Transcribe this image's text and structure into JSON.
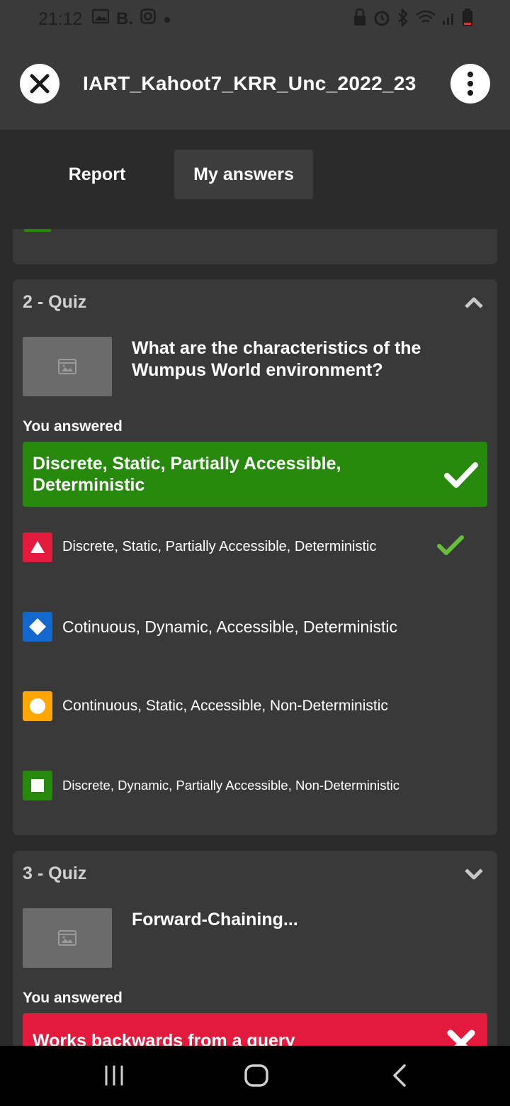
{
  "status_bar": {
    "time": "21:12",
    "left_icons": [
      "image-icon",
      "b-app-icon",
      "instagram-icon",
      "dot-icon"
    ],
    "b_text": "B."
  },
  "header": {
    "title": "IART_Kahoot7_KRR_Unc_2022_23",
    "close_icon": "close-icon",
    "menu_icon": "more-vertical-icon"
  },
  "tabs": [
    {
      "label": "Report",
      "active": false
    },
    {
      "label": "My answers",
      "active": true
    }
  ],
  "questions": [
    {
      "heading": "2 - Quiz",
      "expanded": true,
      "question_pre": "What are the characteristics of the ",
      "question_bold": "Wumpus World",
      "question_post": " environment?",
      "you_answered_label": "You answered",
      "answer": "Discrete, Static, Partially Accessible, Deterministic",
      "answer_correct": true,
      "options": [
        {
          "shape": "triangle",
          "color": "#e21b3c",
          "text": "Discrete, Static, Partially Accessible, Deterministic",
          "correct": true
        },
        {
          "shape": "diamond",
          "color": "#1368ce",
          "text": "Cotinuous, Dynamic, Accessible, Deterministic",
          "correct": false
        },
        {
          "shape": "circle",
          "color": "#ffa602",
          "text": "Continuous, Static, Accessible, Non-Deterministic",
          "correct": false
        },
        {
          "shape": "square",
          "color": "#26890c",
          "text": "Discrete, Dynamic, Partially Accessible, Non-Deterministic",
          "correct": false
        }
      ]
    },
    {
      "heading": "3 - Quiz",
      "expanded": false,
      "question": "Forward-Chaining...",
      "you_answered_label": "You answered",
      "answer": "Works backwards from a query",
      "answer_correct": false
    }
  ],
  "colors": {
    "background": "#2b2b2b",
    "card": "#393939",
    "correct": "#26890c",
    "wrong": "#e21b3c",
    "check": "#66bf39"
  },
  "navbar": [
    "recent-apps-icon",
    "home-icon",
    "back-icon"
  ]
}
